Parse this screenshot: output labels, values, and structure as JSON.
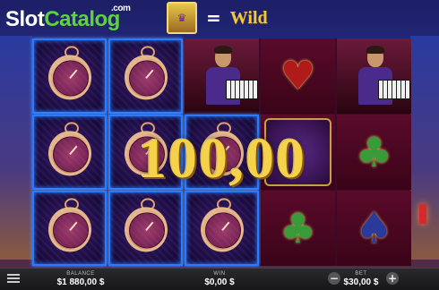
{
  "logo": {
    "slot": "Slot",
    "catalog": "Catalog",
    "com": ".com"
  },
  "legend": {
    "equals": "=",
    "wild": "Wild",
    "icon": "wild-symbol-icon"
  },
  "win_overlay": {
    "amount": "100,00"
  },
  "footer": {
    "balance_label": "BALANCE",
    "balance_value": "$1 880,00 $",
    "win_label": "WIN",
    "win_value": "$0,00 $",
    "bet_label": "BET",
    "bet_value": "$30,00 $",
    "minus": "−",
    "plus": "+"
  },
  "reels": [
    [
      "pocket-watch",
      "pocket-watch",
      "pocket-watch"
    ],
    [
      "pocket-watch",
      "pocket-watch",
      "pocket-watch"
    ],
    [
      "pianist",
      "pocket-watch",
      "pocket-watch"
    ],
    [
      "heart",
      "wild",
      "club"
    ],
    [
      "pianist",
      "club",
      "spade"
    ]
  ],
  "colors": {
    "win_border": "#2a7aff",
    "amount_gold": "#f5d24a",
    "logo_green": "#5fd33a"
  }
}
